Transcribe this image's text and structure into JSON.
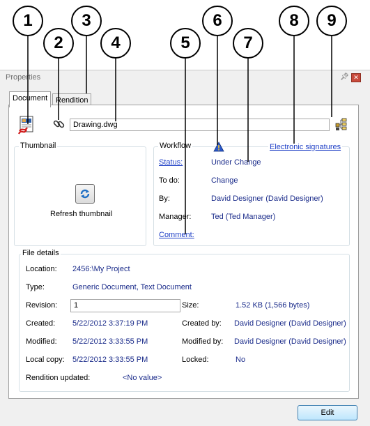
{
  "callouts": [
    "1",
    "2",
    "3",
    "4",
    "5",
    "6",
    "7",
    "8",
    "9"
  ],
  "window": {
    "title": "Properties",
    "pin_icon": "pin-icon",
    "close_icon": "close-icon"
  },
  "tabs": [
    {
      "label": "Document"
    },
    {
      "label": "Rendition"
    }
  ],
  "document": {
    "filename": "Drawing.dwg",
    "doc_icon": "dwg-document-icon",
    "link_icon": "link-icon",
    "tree_icon": "structure-tree-icon"
  },
  "thumbnail": {
    "group_label": "Thumbnail",
    "refresh_label": "Refresh thumbnail"
  },
  "workflow": {
    "group_label": "Workflow",
    "state_icon": "warning-state-icon",
    "esig_link": "Electronic signatures",
    "status_label": "Status:",
    "status_value": "Under Change",
    "todo_label": "To do:",
    "todo_value": "Change",
    "by_label": "By:",
    "by_value": "David Designer (David Designer)",
    "manager_label": "Manager:",
    "manager_value": "Ted (Ted Manager)",
    "comment_link": "Comment:"
  },
  "file_details": {
    "group_label": "File details",
    "location_label": "Location:",
    "location_value": "2456:\\My Project",
    "type_label": "Type:",
    "type_value": "Generic Document, Text Document",
    "revision_label": "Revision:",
    "revision_value": "1",
    "size_label": "Size:",
    "size_value": "1.52 KB (1,566 bytes)",
    "created_label": "Created:",
    "created_value": "5/22/2012 3:37:19 PM",
    "created_by_label": "Created by:",
    "created_by_value": "David Designer (David Designer)",
    "modified_label": "Modified:",
    "modified_value": "5/22/2012 3:33:55 PM",
    "modified_by_label": "Modified by:",
    "modified_by_value": "David Designer (David Designer)",
    "local_copy_label": "Local copy:",
    "local_copy_value": "5/22/2012 3:33:55 PM",
    "locked_label": "Locked:",
    "locked_value": "No",
    "rendition_label": "Rendition updated:",
    "rendition_value": "<No value>"
  },
  "edit_button": "Edit",
  "colors": {
    "value_text": "#1a2b8a",
    "link": "#1e3fc6",
    "close_button": "#c94b3c"
  }
}
